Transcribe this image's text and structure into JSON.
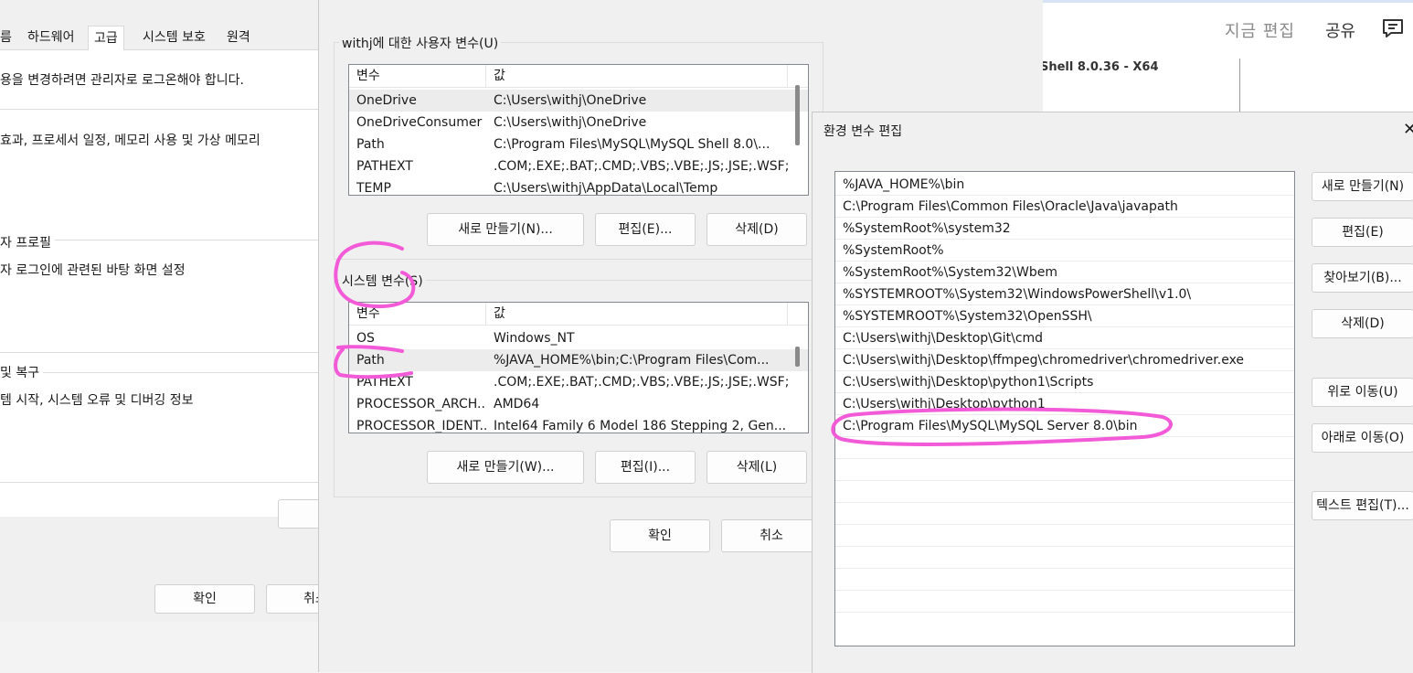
{
  "background_app": {
    "now_edit": "지금 편집",
    "share": "공유",
    "shell_name": "Shell 8.0.36 - X64"
  },
  "system_properties": {
    "tabs": [
      "름",
      "하드웨어",
      "고급",
      "시스템 보호",
      "원격"
    ],
    "admin_note": "용을 변경하려면 관리자로 로그온해야 합니다.",
    "performance_desc": "효과, 프로세서 일정, 메모리 사용 및 가상 메모리",
    "profile_heading": "자 프로필",
    "profile_desc": "자 로그인에 관련된 바탕 화면 설정",
    "recovery_heading": "및 복구",
    "recovery_desc": "템 시작, 시스템 오류 및 디버깅 정보",
    "ok": "확인",
    "cancel": "취소"
  },
  "env_vars": {
    "user_group_label": "withj에 대한 사용자 변수(U)",
    "system_group_label": "시스템 변수(S)",
    "col_variable": "변수",
    "col_value": "값",
    "user_rows": [
      {
        "name": "OneDrive",
        "value": "C:\\Users\\withj\\OneDrive"
      },
      {
        "name": "OneDriveConsumer",
        "value": "C:\\Users\\withj\\OneDrive"
      },
      {
        "name": "Path",
        "value": "C:\\Program Files\\MySQL\\MySQL Shell 8.0\\..."
      },
      {
        "name": "PATHEXT",
        "value": ".COM;.EXE;.BAT;.CMD;.VBS;.VBE;.JS;.JSE;.WSF;..."
      },
      {
        "name": "TEMP",
        "value": "C:\\Users\\withj\\AppData\\Local\\Temp"
      }
    ],
    "system_rows": [
      {
        "name": "OS",
        "value": "Windows_NT"
      },
      {
        "name": "Path",
        "value": "%JAVA_HOME%\\bin;C:\\Program Files\\Com..."
      },
      {
        "name": "PATHEXT",
        "value": ".COM;.EXE;.BAT;.CMD;.VBS;.VBE;.JS;.JSE;.WSF;..."
      },
      {
        "name": "PROCESSOR_ARCH...",
        "value": "AMD64"
      },
      {
        "name": "PROCESSOR_IDENT...",
        "value": "Intel64 Family 6 Model 186 Stepping 2, Gen..."
      }
    ],
    "user_new": "새로 만들기(N)...",
    "user_edit": "편집(E)...",
    "user_delete": "삭제(D)",
    "sys_new": "새로 만들기(W)...",
    "sys_edit": "편집(I)...",
    "sys_delete": "삭제(L)",
    "ok": "확인",
    "cancel": "취소"
  },
  "edit_dialog": {
    "title": "환경 변수 편집",
    "close_glyph": "✕",
    "paths": [
      "%JAVA_HOME%\\bin",
      "C:\\Program Files\\Common Files\\Oracle\\Java\\javapath",
      "%SystemRoot%\\system32",
      "%SystemRoot%",
      "%SystemRoot%\\System32\\Wbem",
      "%SYSTEMROOT%\\System32\\WindowsPowerShell\\v1.0\\",
      "%SYSTEMROOT%\\System32\\OpenSSH\\",
      "C:\\Users\\withj\\Desktop\\Git\\cmd",
      "C:\\Users\\withj\\Desktop\\ffmpeg\\chromedriver\\chromedriver.exe",
      "C:\\Users\\withj\\Desktop\\python1\\Scripts",
      "C:\\Users\\withj\\Desktop\\python1",
      "C:\\Program Files\\MySQL\\MySQL Server 8.0\\bin"
    ],
    "btn_new": "새로 만들기(N)",
    "btn_edit": "편집(E)",
    "btn_browse": "찾아보기(B)...",
    "btn_delete": "삭제(D)",
    "btn_up": "위로 이동(U)",
    "btn_down": "아래로 이동(O)",
    "btn_text": "텍스트 편집(T)..."
  },
  "colors": {
    "annotation": "#f25ad8"
  }
}
